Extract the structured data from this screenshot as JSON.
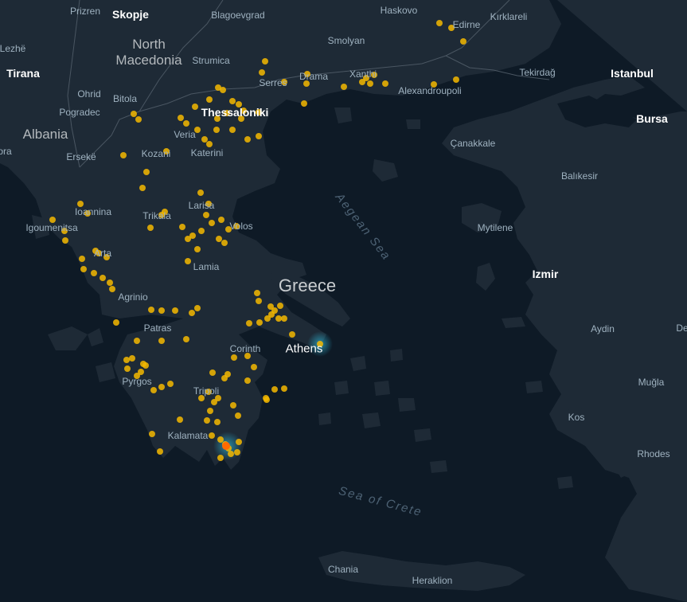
{
  "map": {
    "colors": {
      "sea": "#0e1a26",
      "land": "#1e2a36",
      "border": "#4a5662",
      "point": "#f5b800",
      "point_hot": "#ff6a00",
      "glow": "#2fb7d6"
    },
    "labels": {
      "prizren": "Prizren",
      "skopje": "Skopje",
      "blagoevgrad": "Blagoevgrad",
      "haskovo": "Haskovo",
      "edirne": "Edirne",
      "kirklareli": "Kırklareli",
      "lezhe": "Lezhë",
      "north_macedonia": "North Macedonia",
      "strumica": "Strumica",
      "smolyan": "Smolyan",
      "tirana": "Tirana",
      "ohrid": "Ohrid",
      "serres": "Serres",
      "drama": "Drama",
      "xanthi": "Xanthi",
      "tekirdag": "Tekirdağ",
      "istanbul": "Istanbul",
      "bitola": "Bitola",
      "pogradec": "Pogradec",
      "thessaloniki": "Thessaloniki",
      "alexandroupoli": "Alexandroupoli",
      "bursa": "Bursa",
      "albania": "Albania",
      "veria": "Veria",
      "fora": "ora",
      "ersek": "Ersekë",
      "kozani": "Kozani",
      "katerini": "Katerini",
      "canakkale": "Çanakkale",
      "balikesir": "Balıkesir",
      "ioannina": "Ioannina",
      "larisa": "Larisa",
      "trikala": "Trikala",
      "igoumenitsa": "Igoumenitsa",
      "volos": "Volos",
      "aegean": "Aegean Sea",
      "mytilene": "Mytilene",
      "arta": "Arta",
      "lamia": "Lamia",
      "greece": "Greece",
      "izmir": "Izmir",
      "agrinio": "Agrinio",
      "aydin": "Aydin",
      "de": "De",
      "patras": "Patras",
      "athens": "Athens",
      "corinth": "Corinth",
      "mugla": "Muğla",
      "pyrgos": "Pyrgos",
      "tripoli": "Tripoli",
      "kos": "Kos",
      "kalamata": "Kalamata",
      "rhodes": "Rhodes",
      "sea_of_crete": "Sea of Crete",
      "chania": "Chania",
      "heraklion": "Heraklion"
    }
  }
}
